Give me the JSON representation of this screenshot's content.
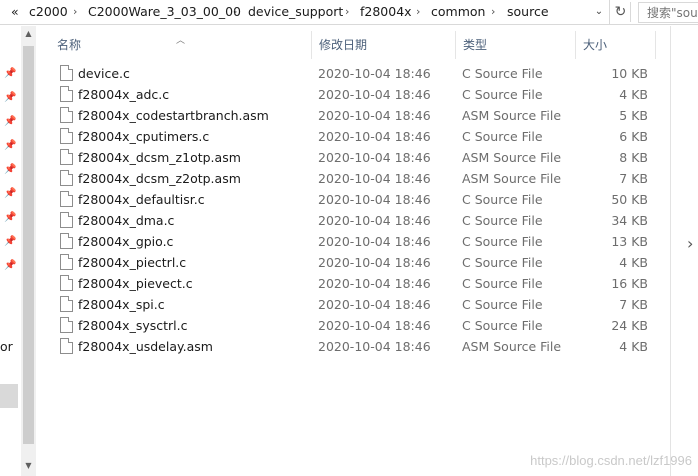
{
  "address": {
    "overflow": "«",
    "crumbs": [
      "c2000",
      "C2000Ware_3_03_00_00",
      "device_support",
      "f28004x",
      "common",
      "source"
    ],
    "separator": "›",
    "dropdown": "⌄",
    "refresh": "↻"
  },
  "search": {
    "placeholder": "搜索\"sou"
  },
  "nav": {
    "partial_label": "or"
  },
  "columns": {
    "name": "名称",
    "date": "修改日期",
    "type": "类型",
    "size": "大小"
  },
  "files": [
    {
      "name": "device.c",
      "date": "2020-10-04 18:46",
      "type": "C Source File",
      "size": "10 KB"
    },
    {
      "name": "f28004x_adc.c",
      "date": "2020-10-04 18:46",
      "type": "C Source File",
      "size": "4 KB"
    },
    {
      "name": "f28004x_codestartbranch.asm",
      "date": "2020-10-04 18:46",
      "type": "ASM Source File",
      "size": "5 KB"
    },
    {
      "name": "f28004x_cputimers.c",
      "date": "2020-10-04 18:46",
      "type": "C Source File",
      "size": "6 KB"
    },
    {
      "name": "f28004x_dcsm_z1otp.asm",
      "date": "2020-10-04 18:46",
      "type": "ASM Source File",
      "size": "8 KB"
    },
    {
      "name": "f28004x_dcsm_z2otp.asm",
      "date": "2020-10-04 18:46",
      "type": "ASM Source File",
      "size": "7 KB"
    },
    {
      "name": "f28004x_defaultisr.c",
      "date": "2020-10-04 18:46",
      "type": "C Source File",
      "size": "50 KB"
    },
    {
      "name": "f28004x_dma.c",
      "date": "2020-10-04 18:46",
      "type": "C Source File",
      "size": "34 KB"
    },
    {
      "name": "f28004x_gpio.c",
      "date": "2020-10-04 18:46",
      "type": "C Source File",
      "size": "13 KB"
    },
    {
      "name": "f28004x_piectrl.c",
      "date": "2020-10-04 18:46",
      "type": "C Source File",
      "size": "4 KB"
    },
    {
      "name": "f28004x_pievect.c",
      "date": "2020-10-04 18:46",
      "type": "C Source File",
      "size": "16 KB"
    },
    {
      "name": "f28004x_spi.c",
      "date": "2020-10-04 18:46",
      "type": "C Source File",
      "size": "7 KB"
    },
    {
      "name": "f28004x_sysctrl.c",
      "date": "2020-10-04 18:46",
      "type": "C Source File",
      "size": "24 KB"
    },
    {
      "name": "f28004x_usdelay.asm",
      "date": "2020-10-04 18:46",
      "type": "ASM Source File",
      "size": "4 KB"
    }
  ],
  "watermark": "https://blog.csdn.net/lzf1996",
  "colors": {
    "header_text": "#4c607a",
    "secondary_text": "#6d6d6d",
    "border": "#d9d9d9"
  }
}
